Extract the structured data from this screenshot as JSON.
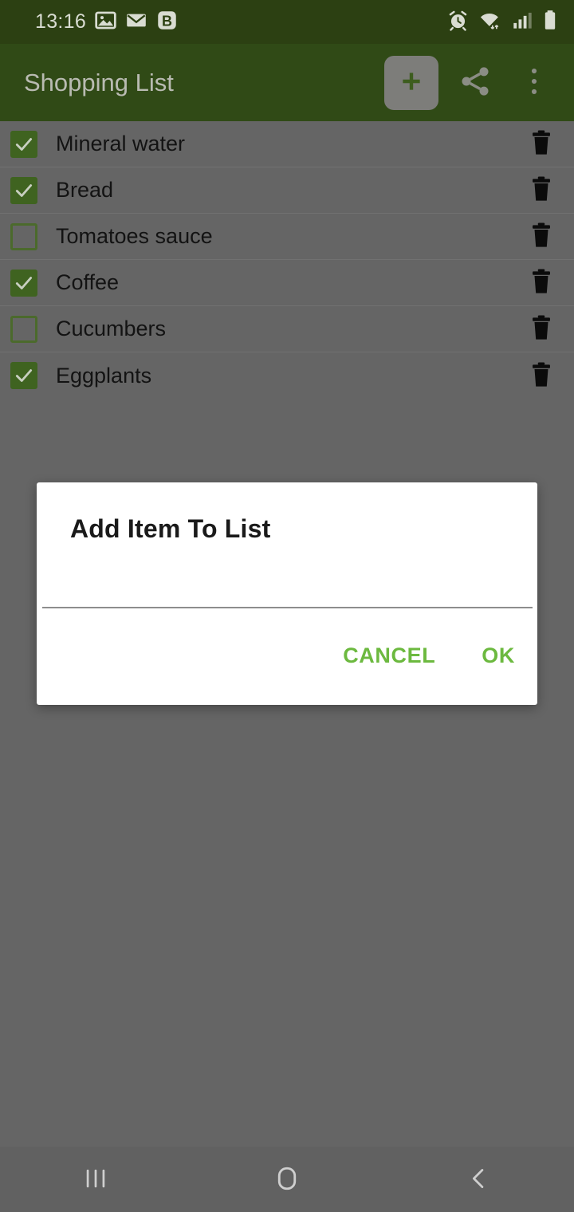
{
  "status_bar": {
    "time": "13:16",
    "left_icons": [
      {
        "name": "gallery-icon",
        "glyph": "image"
      },
      {
        "name": "email-icon",
        "glyph": "envelope"
      },
      {
        "name": "bitwarden-icon",
        "glyph": "B"
      }
    ],
    "right_icons": [
      {
        "name": "alarm-icon",
        "glyph": "alarm"
      },
      {
        "name": "wifi-icon",
        "glyph": "wifi"
      },
      {
        "name": "cellular-signal-icon",
        "glyph": "signal"
      },
      {
        "name": "battery-icon",
        "glyph": "battery"
      }
    ],
    "background_color": "#2c4012"
  },
  "app_bar": {
    "title": "Shopping List",
    "background_color": "#304a16",
    "title_color": "#b9bbb2",
    "actions": [
      {
        "name": "add-item-button",
        "icon": "plus-icon",
        "pressed": true
      },
      {
        "name": "share-button",
        "icon": "share-icon",
        "pressed": false
      },
      {
        "name": "overflow-menu-button",
        "icon": "more-vertical-icon",
        "pressed": false
      }
    ]
  },
  "list": {
    "checkbox_color": "#3f6320",
    "items": [
      {
        "label": "Mineral water",
        "checked": true
      },
      {
        "label": "Bread",
        "checked": true
      },
      {
        "label": "Tomatoes sauce",
        "checked": false
      },
      {
        "label": "Coffee",
        "checked": true
      },
      {
        "label": "Cucumbers",
        "checked": false
      },
      {
        "label": "Eggplants",
        "checked": true
      }
    ],
    "delete_icon": "trash-icon"
  },
  "dialog": {
    "title": "Add Item To List",
    "input_value": "",
    "input_placeholder": "",
    "cancel_label": "CANCEL",
    "ok_label": "OK",
    "accent_color": "#6cb93f"
  },
  "nav_bar": {
    "background_color": "#616161",
    "buttons": [
      {
        "name": "recents-button",
        "icon": "recents-icon"
      },
      {
        "name": "home-button",
        "icon": "home-icon"
      },
      {
        "name": "back-button",
        "icon": "back-chevron-icon"
      }
    ]
  },
  "scrim": {
    "color": "#656565"
  }
}
